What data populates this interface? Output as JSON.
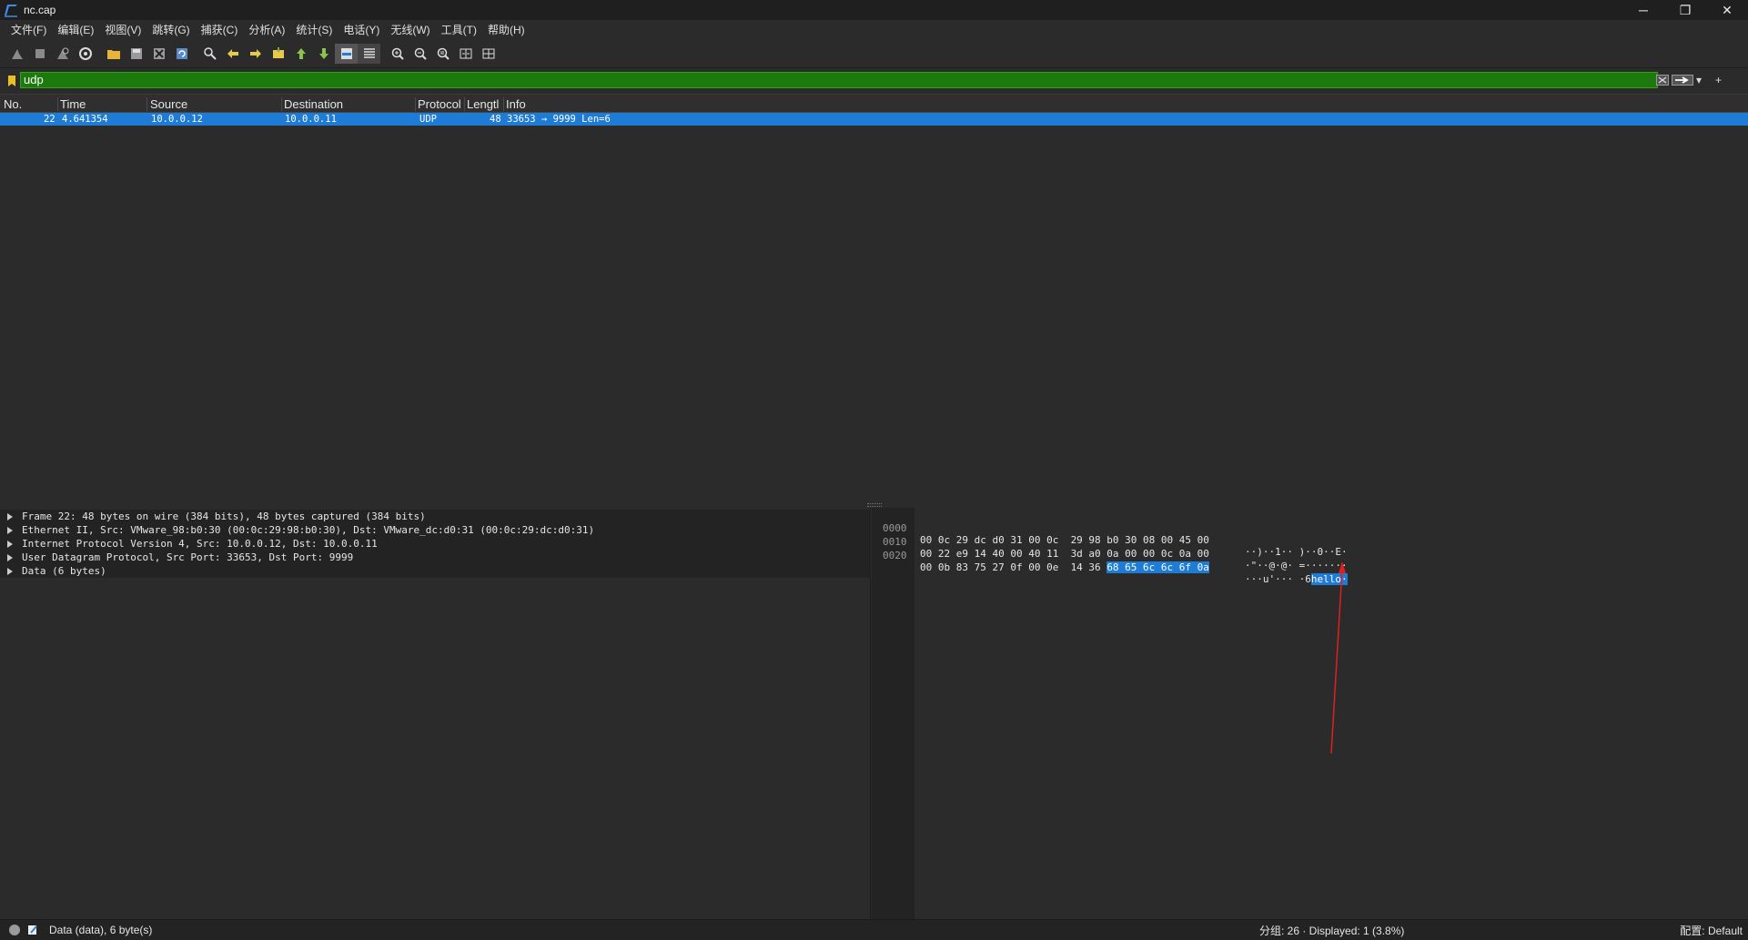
{
  "window": {
    "title": "nc.cap",
    "controls": {
      "minimize": "─",
      "restore": "❐",
      "close": "✕"
    }
  },
  "menu": {
    "items": [
      {
        "label": "文件(F)"
      },
      {
        "label": "编辑(E)"
      },
      {
        "label": "视图(V)"
      },
      {
        "label": "跳转(G)"
      },
      {
        "label": "捕获(C)"
      },
      {
        "label": "分析(A)"
      },
      {
        "label": "统计(S)"
      },
      {
        "label": "电话(Y)"
      },
      {
        "label": "无线(W)"
      },
      {
        "label": "工具(T)"
      },
      {
        "label": "帮助(H)"
      }
    ]
  },
  "toolbar": {
    "icons": [
      "shark-fin-start-icon",
      "stop-icon",
      "restart-icon",
      "capture-options-icon",
      "open-file-icon",
      "save-file-icon",
      "close-file-icon",
      "reload-icon",
      "find-packet-icon",
      "go-back-icon",
      "go-forward-icon",
      "go-to-packet-icon",
      "first-packet-icon",
      "last-packet-icon",
      "autoscroll-icon",
      "colorize-icon",
      "zoom-in-icon",
      "zoom-out-icon",
      "zoom-normal-icon",
      "resize-columns-icon",
      "layout-icon"
    ]
  },
  "filter": {
    "value": "udp",
    "color": "#1c7a0d"
  },
  "packet_list": {
    "columns": [
      "No.",
      "Time",
      "Source",
      "Destination",
      "Protocol",
      "Lengtl",
      "Info"
    ],
    "rows": [
      {
        "no": "22",
        "time": "4.641354",
        "source": "10.0.0.12",
        "destination": "10.0.0.11",
        "protocol": "UDP",
        "length": "48",
        "info": "33653 → 9999 Len=6"
      }
    ],
    "selected_color": "#1e7bd6"
  },
  "details": {
    "rows": [
      {
        "label": "Frame 22: 48 bytes on wire (384 bits), 48 bytes captured (384 bits)"
      },
      {
        "label": "Ethernet II, Src: VMware_98:b0:30 (00:0c:29:98:b0:30), Dst: VMware_dc:d0:31 (00:0c:29:dc:d0:31)"
      },
      {
        "label": "Internet Protocol Version 4, Src: 10.0.0.12, Dst: 10.0.0.11"
      },
      {
        "label": "User Datagram Protocol, Src Port: 33653, Dst Port: 9999"
      },
      {
        "label": "Data (6 bytes)"
      }
    ]
  },
  "bytes": {
    "rows": [
      {
        "offset": "0000",
        "hex": "00 0c 29 dc d0 31 00 0c  29 98 b0 30 08 00 45 00",
        "hex_hl": "",
        "ascii": "··)··1·· )··0··E·",
        "ascii_hl": ""
      },
      {
        "offset": "0010",
        "hex": "00 22 e9 14 40 00 40 11  3d a0 0a 00 00 0c 0a 00",
        "hex_hl": "",
        "ascii": "·\"··@·@· =·······",
        "ascii_hl": ""
      },
      {
        "offset": "0020",
        "hex": "00 0b 83 75 27 0f 00 0e  14 36 ",
        "hex_hl": "68 65 6c 6c 6f 0a",
        "ascii": "···u'··· ·6",
        "ascii_hl": "hello·"
      }
    ]
  },
  "status": {
    "left": "Data (data), 6 byte(s)",
    "middle": "分组: 26 · Displayed: 1 (3.8%)",
    "right": "配置: Default"
  },
  "annotation": {
    "color": "#e02020"
  }
}
